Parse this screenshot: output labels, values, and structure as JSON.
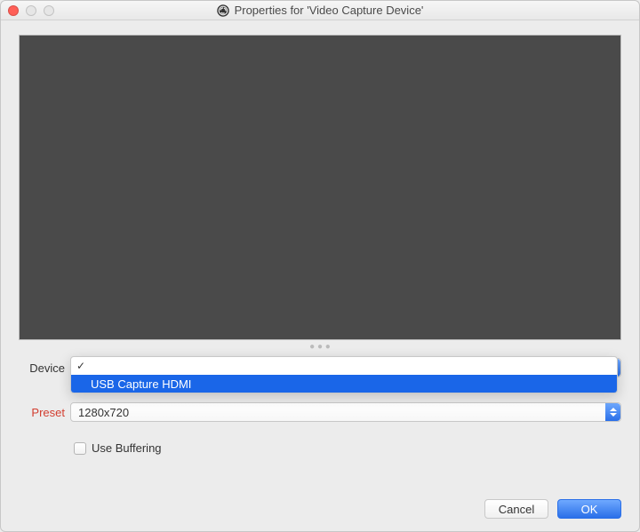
{
  "titlebar": {
    "title": "Properties for 'Video Capture Device'"
  },
  "form": {
    "device": {
      "label": "Device",
      "selected": "",
      "options": [
        {
          "label": "",
          "selected": true,
          "highlighted": false
        },
        {
          "label": "USB Capture HDMI",
          "selected": false,
          "highlighted": true
        }
      ]
    },
    "preset": {
      "label": "Preset",
      "value": "1280x720"
    },
    "use_buffering": {
      "label": "Use Buffering",
      "checked": false
    }
  },
  "footer": {
    "cancel": "Cancel",
    "ok": "OK"
  }
}
